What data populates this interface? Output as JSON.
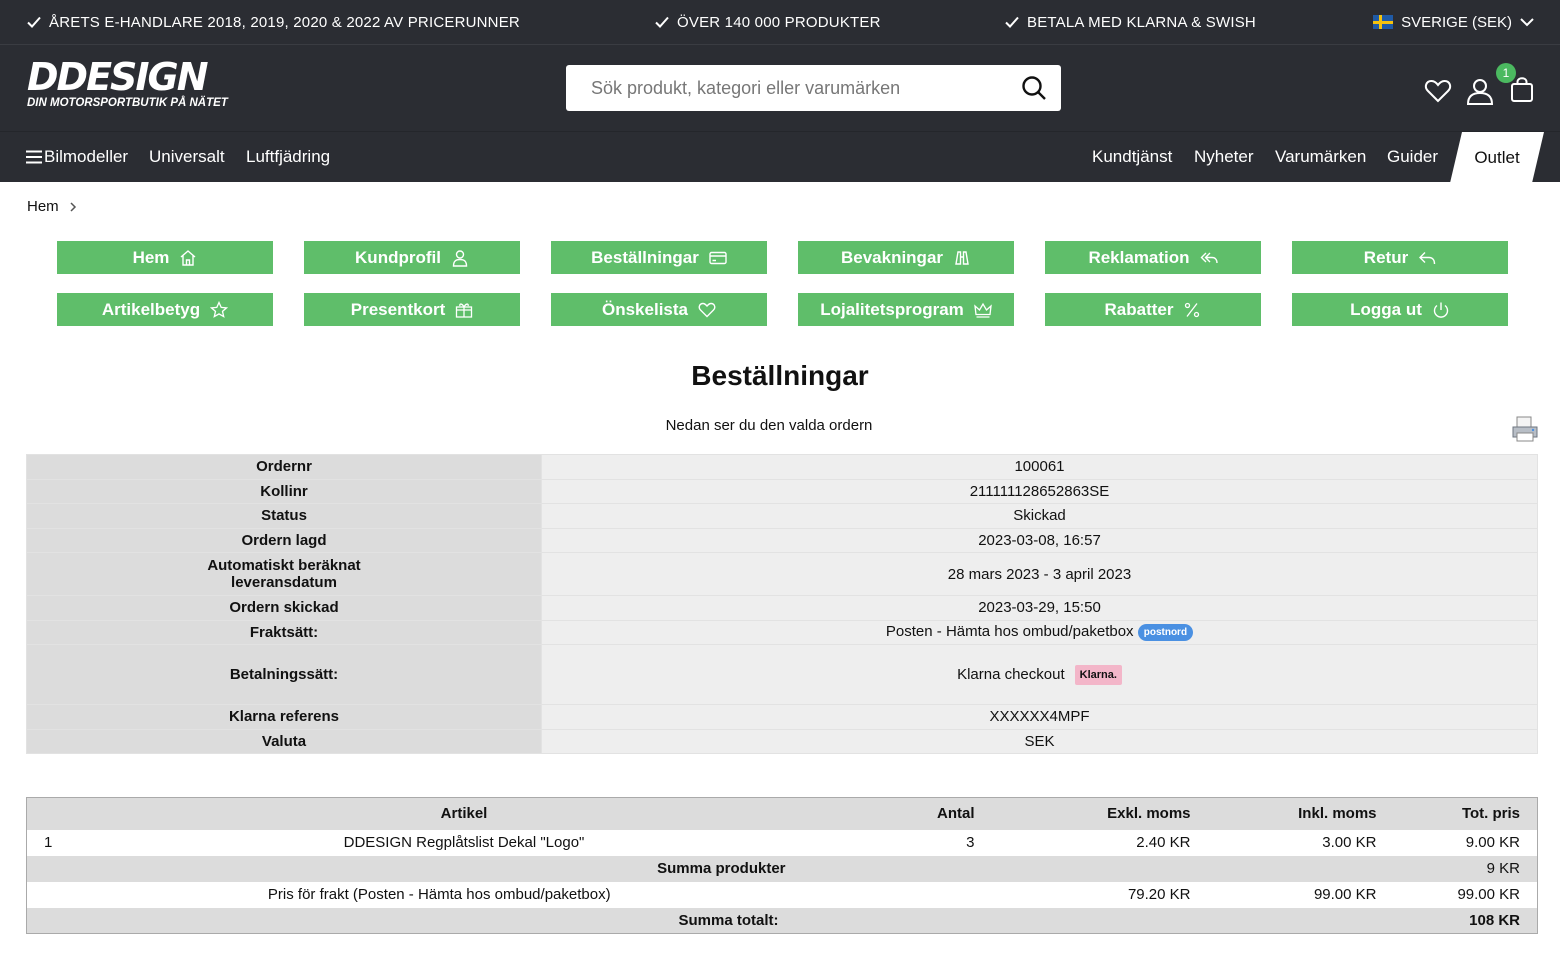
{
  "topbar": {
    "usp": [
      "ÅRETS E-HANDLARE 2018, 2019, 2020 & 2022 AV PRICERUNNER",
      "ÖVER 140 000 PRODUKTER",
      "BETALA MED KLARNA & SWISH"
    ],
    "country": "SVERIGE (SEK)"
  },
  "header": {
    "logo_main": "DDESIGN",
    "logo_tagline": "DIN MOTORSPORTBUTIK PÅ NÄTET",
    "search_placeholder": "Sök produkt, kategori eller varumärken",
    "cart_count": "1"
  },
  "nav": {
    "left": [
      "Bilmodeller",
      "Universalt",
      "Luftfjädring"
    ],
    "right": [
      "Kundtjänst",
      "Nyheter",
      "Varumärken",
      "Guider"
    ],
    "outlet": "Outlet"
  },
  "breadcrumb": [
    "Hem"
  ],
  "account_menu": [
    {
      "label": "Hem",
      "icon": "home-icon"
    },
    {
      "label": "Kundprofil",
      "icon": "user-icon"
    },
    {
      "label": "Beställningar",
      "icon": "credit-card-icon"
    },
    {
      "label": "Bevakningar",
      "icon": "binoculars-icon"
    },
    {
      "label": "Reklamation",
      "icon": "reply-all-icon"
    },
    {
      "label": "Retur",
      "icon": "reply-icon"
    },
    {
      "label": "Artikelbetyg",
      "icon": "star-icon"
    },
    {
      "label": "Presentkort",
      "icon": "gift-icon"
    },
    {
      "label": "Önskelista",
      "icon": "heart-icon"
    },
    {
      "label": "Lojalitetsprogram",
      "icon": "crown-icon"
    },
    {
      "label": "Rabatter",
      "icon": "percent-icon"
    },
    {
      "label": "Logga ut",
      "icon": "power-icon"
    }
  ],
  "page_title": "Beställningar",
  "subtitle": "Nedan ser du den valda ordern",
  "order": {
    "rows": [
      {
        "key": "Ordernr",
        "value": "100061"
      },
      {
        "key": "Kollinr",
        "value": "211111128652863SE"
      },
      {
        "key": "Status",
        "value": "Skickad"
      },
      {
        "key": "Ordern lagd",
        "value": "2023-03-08, 16:57"
      },
      {
        "key": "Automatiskt beräknat leveransdatum",
        "value": "28 mars 2023 - 3 april 2023"
      },
      {
        "key": "Ordern skickad",
        "value": "2023-03-29, 15:50"
      },
      {
        "key": "Fraktsätt:",
        "value": "Posten - Hämta hos ombud/paketbox",
        "badge": "postnord"
      },
      {
        "key": "Betalningssätt:",
        "value": "Klarna checkout",
        "badge": "Klarna."
      },
      {
        "key": "Klarna referens",
        "value": "XXXXXX4MPF"
      },
      {
        "key": "Valuta",
        "value": "SEK"
      }
    ]
  },
  "items": {
    "headers": [
      "",
      "Artikel",
      "Antal",
      "Exkl. moms",
      "Inkl. moms",
      "Tot. pris"
    ],
    "rows": [
      [
        "1",
        "DDESIGN Regplåtslist Dekal \"Logo\"",
        "3",
        "2.40 KR",
        "3.00 KR",
        "9.00 KR"
      ]
    ],
    "sum_products_label": "Summa produkter",
    "sum_products_value": "9 KR",
    "shipping": [
      "Pris för frakt (Posten - Hämta hos ombud/paketbox)",
      "79.20 KR",
      "99.00 KR",
      "99.00 KR"
    ],
    "sum_total_label": "Summa totalt:",
    "sum_total_value": "108 KR"
  },
  "colors": {
    "dark": "#2b2d33",
    "accent_green": "#5fbe6a",
    "badge_green": "#4bb960"
  }
}
